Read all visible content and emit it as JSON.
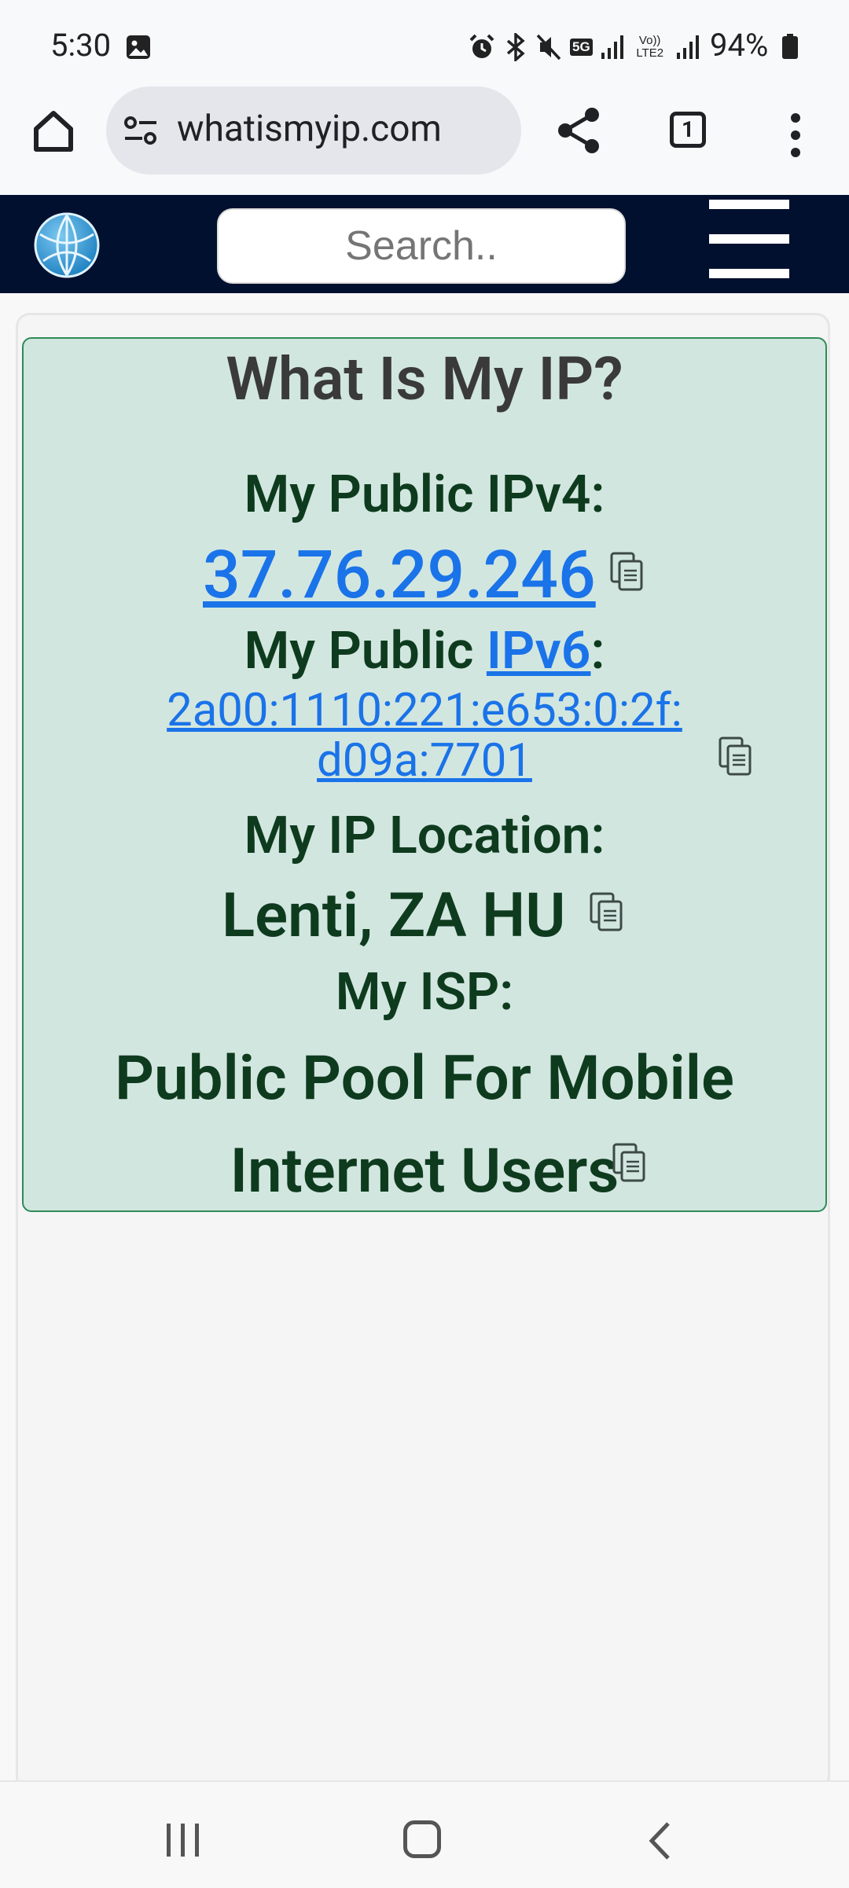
{
  "status_bar": {
    "time": "5:30",
    "network": "5G",
    "volte": "Vo)) LTE2",
    "battery": "94%"
  },
  "browser": {
    "url": "whatismyip.com",
    "tab_count": "1"
  },
  "site": {
    "search_placeholder": "Search.."
  },
  "ip_card": {
    "title": "What Is My IP?",
    "ipv4_label": "My Public IPv4:",
    "ipv4": "37.76.29.246",
    "ipv6_label_prefix": "My Public ",
    "ipv6_label_link": "IPv6",
    "ipv6_label_suffix": ":",
    "ipv6_line1": "2a00:1110:221:e653:0:2f:",
    "ipv6_line2": "d09a:7701",
    "location_label": "My IP Location:",
    "location": "Lenti, ZA HU",
    "isp_label": "My ISP:",
    "isp_line1": "Public Pool For Mobile",
    "isp_line2": "Internet Users"
  },
  "colors": {
    "header_bg": "#01102e",
    "card_bg": "#d2e6e0",
    "card_border": "#2e8b57",
    "link": "#1a73e8",
    "label_text": "#0e3b1e"
  }
}
